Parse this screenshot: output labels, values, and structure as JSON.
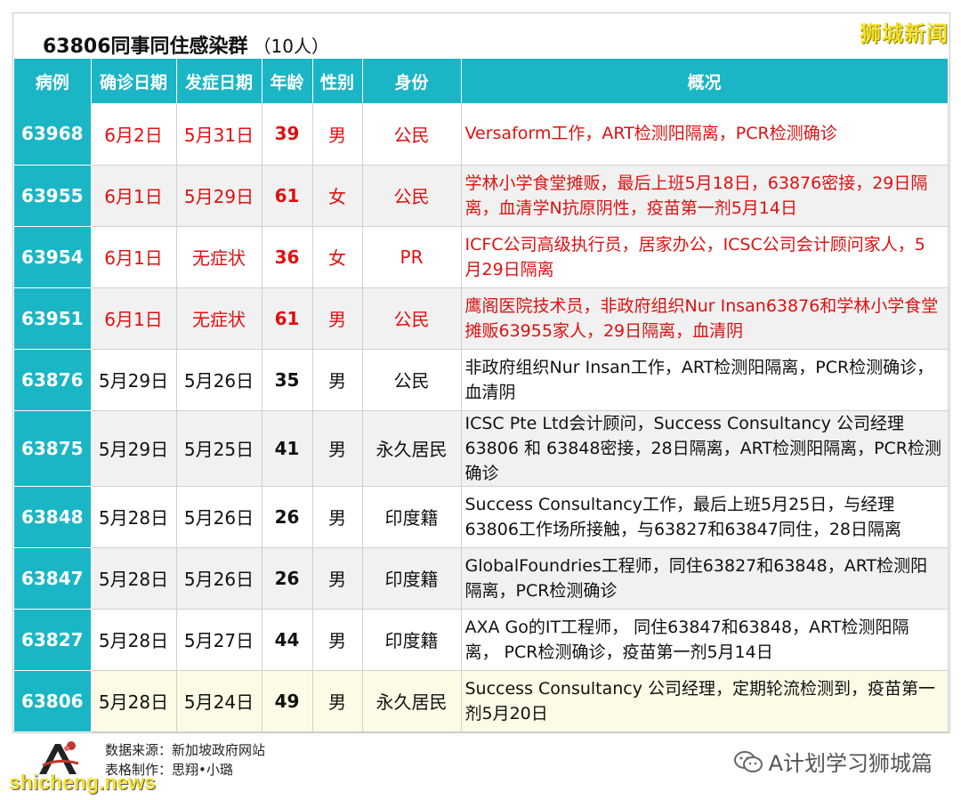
{
  "title": "63806同事同住感染群",
  "title_count": "（10人）",
  "brand_top": "狮城新闻",
  "headers": [
    "病例",
    "确诊日期",
    "发症日期",
    "年龄",
    "性别",
    "身份",
    "概况"
  ],
  "rows": [
    {
      "id": "63968",
      "confirm": "6月2日",
      "onset": "5月31日",
      "age": "39",
      "sex": "男",
      "status": "公民",
      "desc": "Versaform工作，ART检测阳隔离，PCR检测确诊"
    },
    {
      "id": "63955",
      "confirm": "6月1日",
      "onset": "5月29日",
      "age": "61",
      "sex": "女",
      "status": "公民",
      "desc": "学林小学食堂摊贩，最后上班5月18日，63876密接，29日隔离，血清学N抗原阴性，疫苗第一剂5月14日"
    },
    {
      "id": "63954",
      "confirm": "6月1日",
      "onset": "无症状",
      "age": "36",
      "sex": "女",
      "status": "PR",
      "desc": "ICFC公司高级执行员，居家办公，ICSC公司会计顾问家人，5月29日隔离"
    },
    {
      "id": "63951",
      "confirm": "6月1日",
      "onset": "无症状",
      "age": "61",
      "sex": "男",
      "status": "公民",
      "desc": "鹰阁医院技术员，非政府组织Nur Insan63876和学林小学食堂摊贩63955家人，29日隔离，血清阴"
    },
    {
      "id": "63876",
      "confirm": "5月29日",
      "onset": "5月26日",
      "age": "35",
      "sex": "男",
      "status": "公民",
      "desc": "非政府组织Nur Insan工作，ART检测阳隔离，PCR检测确诊，血清阴"
    },
    {
      "id": "63875",
      "confirm": "5月29日",
      "onset": "5月25日",
      "age": "41",
      "sex": "男",
      "status": "永久居民",
      "desc": "ICSC Pte Ltd会计顾问，Success Consultancy 公司经理63806 和 63848密接，28日隔离，ART检测阳隔离，PCR检测确诊"
    },
    {
      "id": "63848",
      "confirm": "5月28日",
      "onset": "5月26日",
      "age": "26",
      "sex": "男",
      "status": "印度籍",
      "desc": "Success Consultancy工作，最后上班5月25日，与经理63806工作场所接触，与63827和63847同住，28日隔离"
    },
    {
      "id": "63847",
      "confirm": "5月28日",
      "onset": "5月26日",
      "age": "26",
      "sex": "男",
      "status": "印度籍",
      "desc": "GlobalFoundries工程师，同住63827和63848，ART检测阳隔离，PCR检测确诊"
    },
    {
      "id": "63827",
      "confirm": "5月28日",
      "onset": "5月27日",
      "age": "44",
      "sex": "男",
      "status": "印度籍",
      "desc": "AXA Go的IT工程师， 同住63847和63848，ART检测阳隔离， PCR检测确诊，疫苗第一剂5月14日"
    },
    {
      "id": "63806",
      "confirm": "5月28日",
      "onset": "5月24日",
      "age": "49",
      "sex": "男",
      "status": "永久居民",
      "desc": "Success Consultancy 公司经理，定期轮流检测到，疫苗第一剂5月20日"
    }
  ],
  "footer": {
    "source": "数据来源：新加坡政府网站",
    "maker": "表格制作：思翔•小璐",
    "site_watermark": "shicheng.news",
    "wechat_watermark": "A计划学习狮城篇"
  },
  "colors": {
    "header_bg": "#1ab6c6",
    "highlight_text": "#e01010",
    "watermark": "#f3e02e"
  },
  "icons": [
    "logo-emblem-icon",
    "wechat-icon"
  ]
}
